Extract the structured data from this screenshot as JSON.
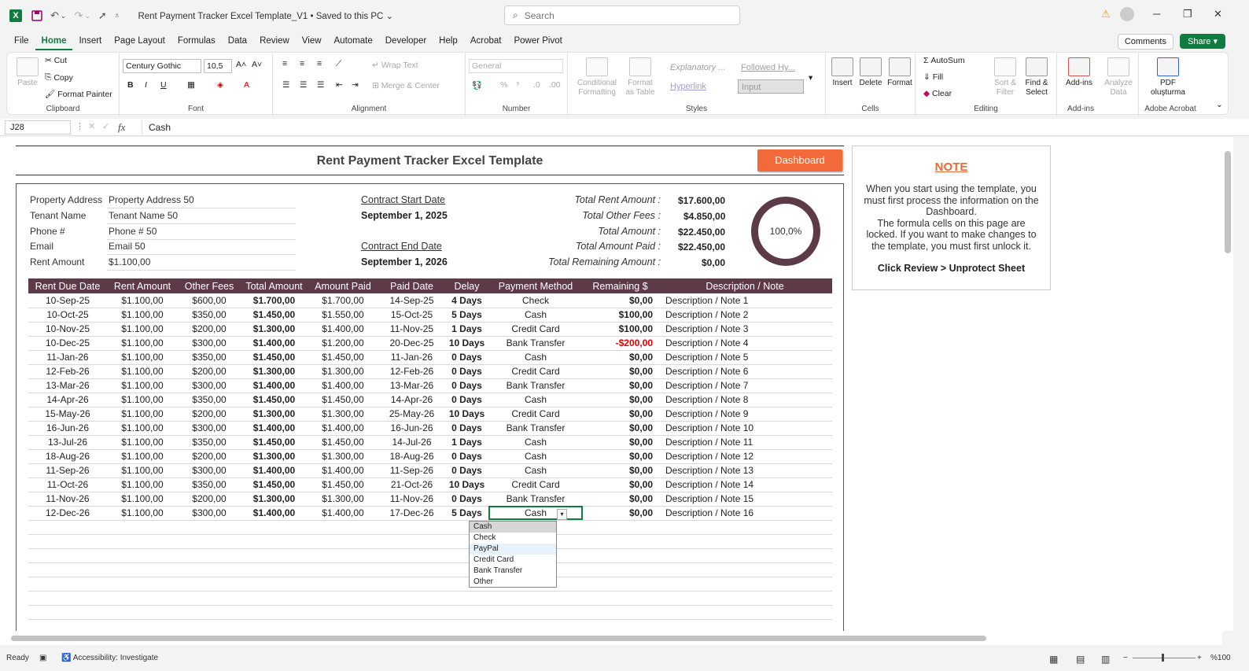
{
  "titlebar": {
    "doc_title": "Rent Payment Tracker Excel Template_V1 • Saved to this PC ⌄",
    "search_placeholder": "Search"
  },
  "menu": [
    "File",
    "Home",
    "Insert",
    "Page Layout",
    "Formulas",
    "Data",
    "Review",
    "View",
    "Automate",
    "Developer",
    "Help",
    "Acrobat",
    "Power Pivot"
  ],
  "menu_active": "Home",
  "header_buttons": {
    "comments": "Comments",
    "share": "Share ▾"
  },
  "ribbon": {
    "clipboard": {
      "label": "Clipboard",
      "paste": "Paste",
      "cut": "Cut",
      "copy": "Copy",
      "format_painter": "Format Painter"
    },
    "font": {
      "label": "Font",
      "font_name": "Century Gothic",
      "font_size": "10,5"
    },
    "alignment": {
      "label": "Alignment",
      "wrap_text": "Wrap Text",
      "merge_center": "Merge & Center"
    },
    "number": {
      "label": "Number",
      "format": "General"
    },
    "styles": {
      "label": "Styles",
      "conditional": "Conditional Formatting",
      "format_table": "Format as Table",
      "explanatory": "Explanatory ...",
      "followed": "Followed Hy...",
      "hyperlink": "Hyperlink",
      "input": "Input"
    },
    "cells": {
      "label": "Cells",
      "insert": "Insert",
      "delete": "Delete",
      "format": "Format"
    },
    "editing": {
      "label": "Editing",
      "autosum": "AutoSum",
      "fill": "Fill",
      "clear": "Clear",
      "sort_filter": "Sort & Filter",
      "find_select": "Find & Select"
    },
    "addins": {
      "label": "Add-ins",
      "addins": "Add-ins",
      "analyze": "Analyze Data"
    },
    "acrobat": {
      "label": "Adobe Acrobat",
      "pdf": "PDF oluşturma"
    }
  },
  "formula_bar": {
    "cell_ref": "J28",
    "value": "Cash"
  },
  "sheet": {
    "title": "Rent Payment Tracker Excel Template",
    "dashboard_button": "Dashboard",
    "property": {
      "labels": [
        "Property Address",
        "Tenant Name",
        "Phone #",
        "Email",
        "Rent Amount"
      ],
      "values": [
        "Property Address 50",
        "Tenant Name 50",
        "Phone # 50",
        "Email 50",
        "$1.100,00"
      ]
    },
    "contract": {
      "start_label": "Contract Start Date",
      "start_value": "September 1, 2025",
      "end_label": "Contract End Date",
      "end_value": "September 1, 2026"
    },
    "totals": {
      "labels": [
        "Total Rent Amount :",
        "Total Other Fees :",
        "Total Amount :",
        "Total Amount Paid :",
        "Total Remaining Amount :"
      ],
      "values": [
        "$17.600,00",
        "$4.850,00",
        "$22.450,00",
        "$22.450,00",
        "$0,00"
      ]
    },
    "donut_percent": "100,0%",
    "note": {
      "title": "NOTE",
      "text1": "When you start using the template, you must first process the information on the Dashboard.",
      "text2": "The formula cells on this page are locked. If you want to make changes to the template, you must first unlock it.",
      "bold": "Click Review > Unprotect Sheet"
    },
    "table": {
      "headers": [
        "Rent Due Date",
        "Rent Amount",
        "Other Fees",
        "Total Amount",
        "Amount Paid",
        "Paid Date",
        "Delay",
        "Payment Method",
        "Remaining $",
        "Description / Note"
      ],
      "rows": [
        [
          "10-Sep-25",
          "$1.100,00",
          "$600,00",
          "$1.700,00",
          "$1.700,00",
          "14-Sep-25",
          "4 Days",
          "Check",
          "$0,00",
          "Description / Note 1"
        ],
        [
          "10-Oct-25",
          "$1.100,00",
          "$350,00",
          "$1.450,00",
          "$1.550,00",
          "15-Oct-25",
          "5 Days",
          "Cash",
          "$100,00",
          "Description / Note 2"
        ],
        [
          "10-Nov-25",
          "$1.100,00",
          "$200,00",
          "$1.300,00",
          "$1.400,00",
          "11-Nov-25",
          "1 Days",
          "Credit Card",
          "$100,00",
          "Description / Note 3"
        ],
        [
          "10-Dec-25",
          "$1.100,00",
          "$300,00",
          "$1.400,00",
          "$1.200,00",
          "20-Dec-25",
          "10 Days",
          "Bank Transfer",
          "-$200,00",
          "Description / Note 4"
        ],
        [
          "11-Jan-26",
          "$1.100,00",
          "$350,00",
          "$1.450,00",
          "$1.450,00",
          "11-Jan-26",
          "0 Days",
          "Cash",
          "$0,00",
          "Description / Note 5"
        ],
        [
          "12-Feb-26",
          "$1.100,00",
          "$200,00",
          "$1.300,00",
          "$1.300,00",
          "12-Feb-26",
          "0 Days",
          "Credit Card",
          "$0,00",
          "Description / Note 6"
        ],
        [
          "13-Mar-26",
          "$1.100,00",
          "$300,00",
          "$1.400,00",
          "$1.400,00",
          "13-Mar-26",
          "0 Days",
          "Bank Transfer",
          "$0,00",
          "Description / Note 7"
        ],
        [
          "14-Apr-26",
          "$1.100,00",
          "$350,00",
          "$1.450,00",
          "$1.450,00",
          "14-Apr-26",
          "0 Days",
          "Cash",
          "$0,00",
          "Description / Note 8"
        ],
        [
          "15-May-26",
          "$1.100,00",
          "$200,00",
          "$1.300,00",
          "$1.300,00",
          "25-May-26",
          "10 Days",
          "Credit Card",
          "$0,00",
          "Description / Note 9"
        ],
        [
          "16-Jun-26",
          "$1.100,00",
          "$300,00",
          "$1.400,00",
          "$1.400,00",
          "16-Jun-26",
          "0 Days",
          "Bank Transfer",
          "$0,00",
          "Description / Note 10"
        ],
        [
          "13-Jul-26",
          "$1.100,00",
          "$350,00",
          "$1.450,00",
          "$1.450,00",
          "14-Jul-26",
          "1 Days",
          "Cash",
          "$0,00",
          "Description / Note 11"
        ],
        [
          "18-Aug-26",
          "$1.100,00",
          "$200,00",
          "$1.300,00",
          "$1.300,00",
          "18-Aug-26",
          "0 Days",
          "Cash",
          "$0,00",
          "Description / Note 12"
        ],
        [
          "11-Sep-26",
          "$1.100,00",
          "$300,00",
          "$1.400,00",
          "$1.400,00",
          "11-Sep-26",
          "0 Days",
          "Cash",
          "$0,00",
          "Description / Note 13"
        ],
        [
          "11-Oct-26",
          "$1.100,00",
          "$350,00",
          "$1.450,00",
          "$1.450,00",
          "21-Oct-26",
          "10 Days",
          "Credit Card",
          "$0,00",
          "Description / Note 14"
        ],
        [
          "11-Nov-26",
          "$1.100,00",
          "$200,00",
          "$1.300,00",
          "$1.300,00",
          "11-Nov-26",
          "0 Days",
          "Bank Transfer",
          "$0,00",
          "Description / Note 15"
        ],
        [
          "12-Dec-26",
          "$1.100,00",
          "$300,00",
          "$1.400,00",
          "$1.400,00",
          "17-Dec-26",
          "5 Days",
          "Cash",
          "$0,00",
          "Description / Note 16"
        ]
      ]
    },
    "dropdown_options": [
      "Cash",
      "Check",
      "PayPal",
      "Credit Card",
      "Bank Transfer",
      "Other"
    ],
    "dropdown_selected": "Cash",
    "dropdown_hover": "PayPal"
  },
  "statusbar": {
    "ready": "Ready",
    "accessibility": "Accessibility: Investigate",
    "zoom": "%100"
  },
  "colors": {
    "header_bg": "#5c3a48",
    "dashboard_btn": "#f2693a",
    "note_title": "#e66a35",
    "excel_green": "#107c41",
    "negative": "#e00000"
  }
}
